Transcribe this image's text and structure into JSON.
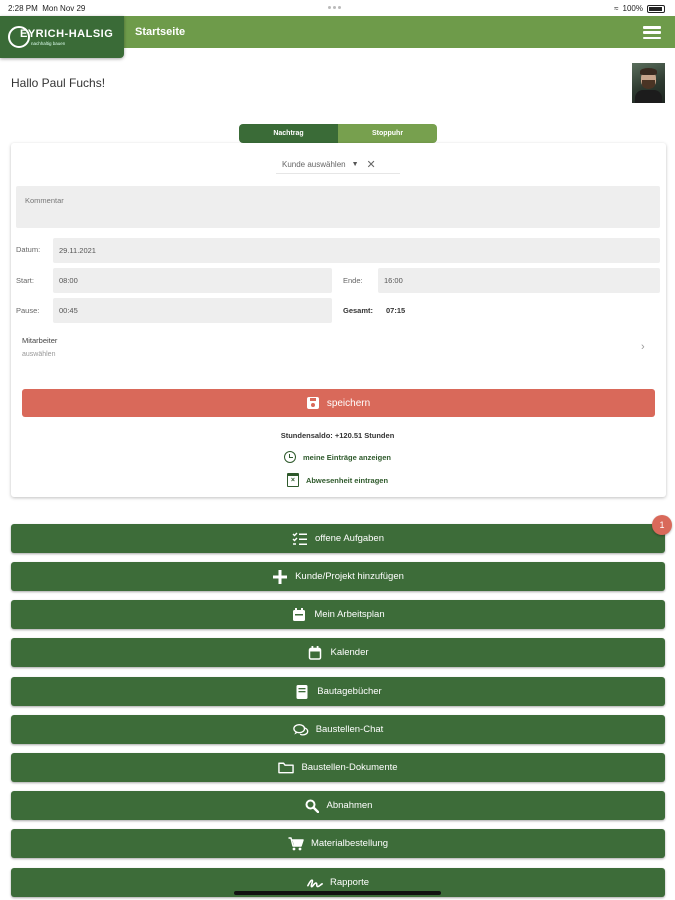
{
  "status": {
    "time": "2:28 PM",
    "date": "Mon Nov 29",
    "battery": "100%"
  },
  "header": {
    "logo_text": "EYRICH-HALSIG",
    "logo_sub": "nachhaltig bauen",
    "title": "Startseite"
  },
  "greeting": "Hallo Paul Fuchs!",
  "mode_toggle": {
    "options": [
      "Nachtrag",
      "Stoppuhr"
    ],
    "selected": "Nachtrag"
  },
  "form": {
    "customer_placeholder": "Kunde auswählen",
    "comment_placeholder": "Kommentar",
    "date_label": "Datum:",
    "date_value": "29.11.2021",
    "start_label": "Start:",
    "start_value": "08:00",
    "end_label": "Ende:",
    "end_value": "16:00",
    "pause_label": "Pause:",
    "pause_value": "00:45",
    "total_label": "Gesamt:",
    "total_value": "07:15",
    "employee_label": "Mitarbeiter",
    "employee_placeholder": "auswählen",
    "save_label": "speichern",
    "balance": "Stundensaldo: +120.51 Stunden",
    "my_entries_link": "meine Einträge anzeigen",
    "absence_link": "Abwesenheit eintragen"
  },
  "menu": [
    {
      "label": "offene Aufgaben",
      "icon": "task-list-icon",
      "badge": "1"
    },
    {
      "label": "Kunde/Projekt hinzufügen",
      "icon": "plus-icon"
    },
    {
      "label": "Mein Arbeitsplan",
      "icon": "calendar-filled-icon"
    },
    {
      "label": "Kalender",
      "icon": "calendar-icon"
    },
    {
      "label": "Bautagebücher",
      "icon": "book-icon"
    },
    {
      "label": "Baustellen-Chat",
      "icon": "chat-icon"
    },
    {
      "label": "Baustellen-Dokumente",
      "icon": "folder-icon"
    },
    {
      "label": "Abnahmen",
      "icon": "search-icon"
    },
    {
      "label": "Materialbestellung",
      "icon": "cart-icon"
    },
    {
      "label": "Rapporte",
      "icon": "signature-icon"
    }
  ],
  "colors": {
    "header_green": "#6e9b4a",
    "dark_green": "#3d6c39",
    "save_red": "#d9695a"
  }
}
